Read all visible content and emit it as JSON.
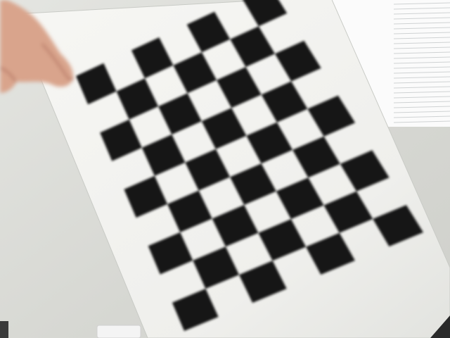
{
  "scene": {
    "subject": "checkerboard-calibration-target",
    "board": {
      "rows": 9,
      "cols": 7,
      "square_color": "#151515",
      "light_square_color": "#f2f2ef",
      "sheet_color": "#f4f4f1"
    },
    "colors": {
      "wall": "#d9dad5",
      "window_light": "#fbfbfb",
      "blind_line": "#cfd2d3",
      "skin": "#d9a48c",
      "skin_shadow": "#b97c68",
      "sheet_edge": "#c9cbc6"
    }
  }
}
